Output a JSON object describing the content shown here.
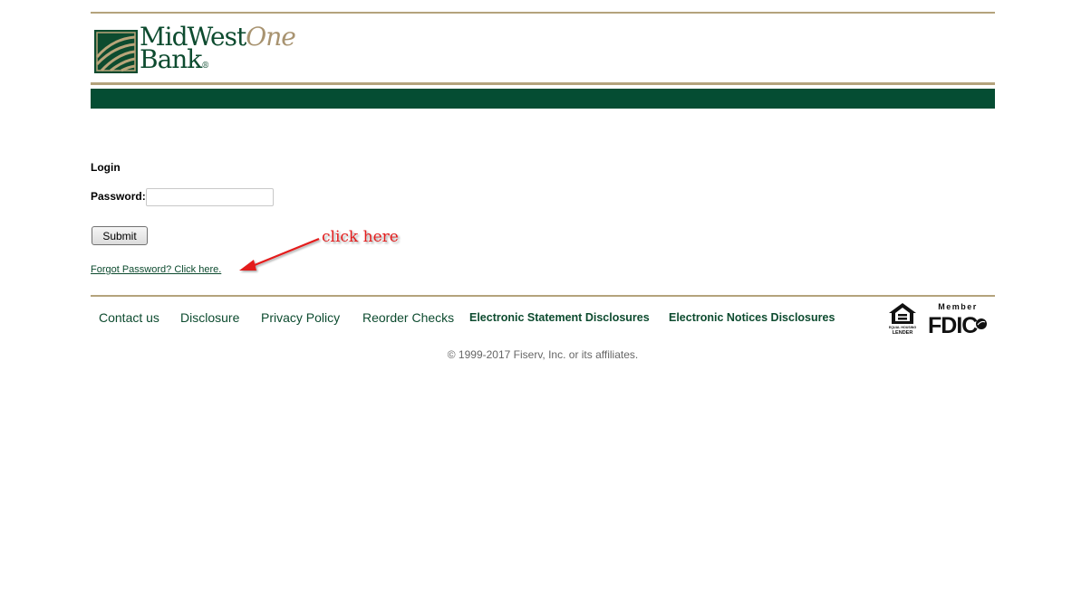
{
  "header": {
    "logo_line1_a": "MidWest",
    "logo_line1_b": "One",
    "logo_line2": "Bank",
    "logo_reg": "®"
  },
  "login": {
    "heading": "Login",
    "password_label": "Password:",
    "password_value": "",
    "submit_label": "Submit",
    "forgot_link": "Forgot Password? Click here."
  },
  "annotation": {
    "text": "click here",
    "color": "#e31b1b"
  },
  "footer": {
    "links": [
      "Contact us",
      "Disclosure",
      "Privacy Policy",
      "Reorder Checks",
      "Electronic Statement Disclosures",
      "Electronic Notices Disclosures"
    ],
    "badges": {
      "equal_housing": "EQUAL HOUSING LENDER",
      "fdic_member": "Member",
      "fdic": "FDIC"
    },
    "copyright": "© 1999-2017 Fiserv, Inc. or its affiliates."
  },
  "colors": {
    "brand_green": "#054d33",
    "brand_gold": "#b4a37c",
    "link_green": "#0d4b2f"
  }
}
